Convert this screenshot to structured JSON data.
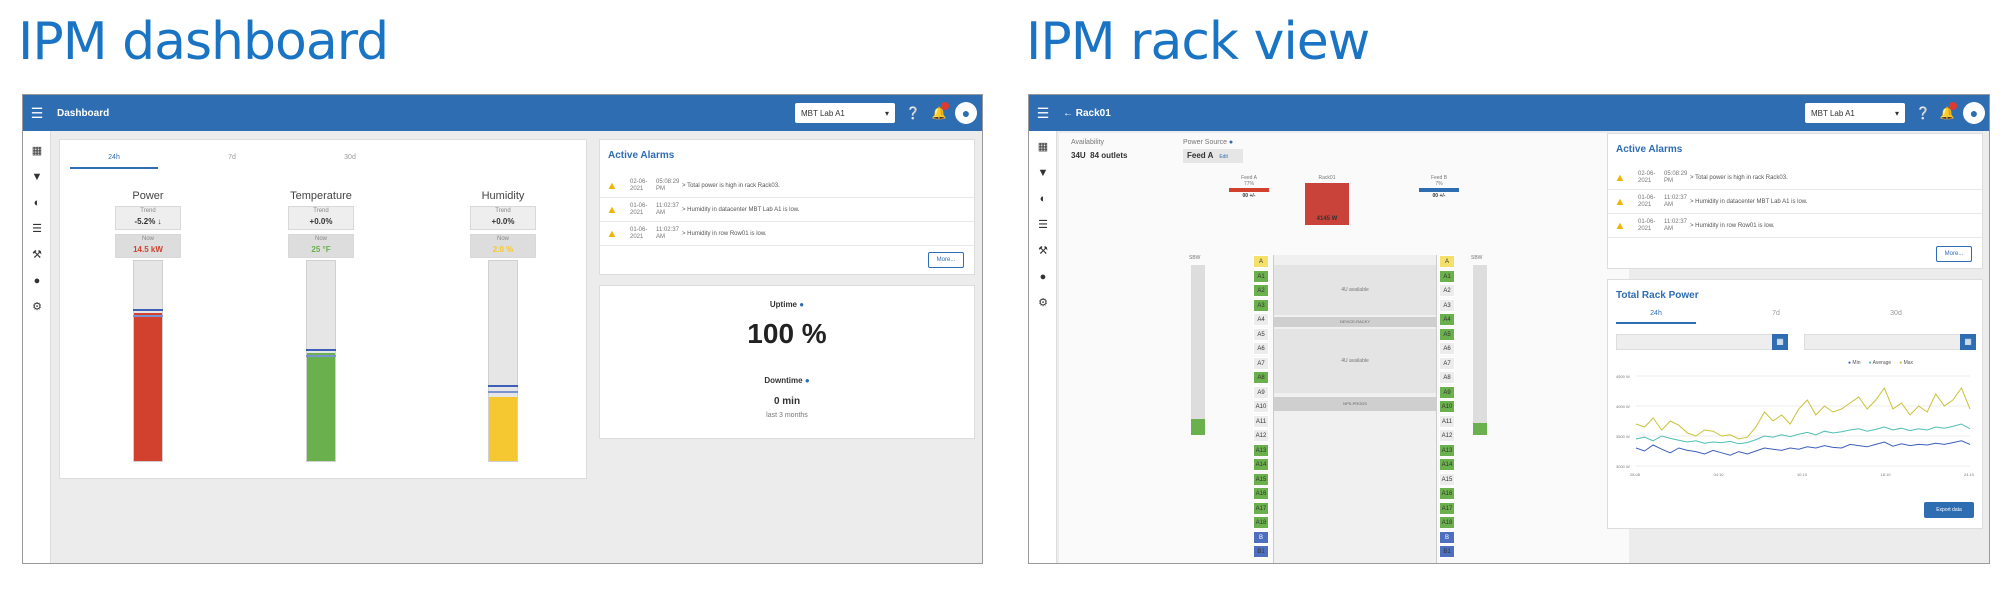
{
  "headings": {
    "left": "IPM dashboard",
    "right": "IPM rack view"
  },
  "colors": {
    "topbar": "#2f6db3",
    "heading": "#1a74c4",
    "red": "#d2402e",
    "green": "#6ab04c",
    "yellow": "#f5c730",
    "alarm": "#f0b400"
  },
  "dashboard": {
    "title": "Dashboard",
    "lab_select": "MBT Lab A1",
    "tabs": [
      "24h",
      "7d",
      "30d"
    ],
    "gauges": [
      {
        "title": "Power",
        "trend_label": "Trend",
        "trend": "-5.2% ↓",
        "now_label": "Now",
        "now": "14.5 kW",
        "level": 0.74
      },
      {
        "title": "Temperature",
        "trend_label": "Trend",
        "trend": "+0.0%",
        "now_label": "Now",
        "now": "25 °F",
        "level": 0.54
      },
      {
        "title": "Humidity",
        "trend_label": "Trend",
        "trend": "+0.0%",
        "now_label": "Now",
        "now": "2.0 %",
        "level": 0.32
      }
    ],
    "alarms": {
      "title": "Active Alarms",
      "rows": [
        {
          "date": "02-06-2021",
          "time": "05:08:29 PM",
          "msg": "> Total power is high in rack Rack03."
        },
        {
          "date": "01-06-2021",
          "time": "11:02:37 AM",
          "msg": "> Humidity in datacenter MBT Lab A1 is low."
        },
        {
          "date": "01-06-2021",
          "time": "11:02:37 AM",
          "msg": "> Humidity in row Row01 is low."
        }
      ],
      "more": "More..."
    },
    "uptime": {
      "label": "Uptime",
      "value": "100 %",
      "downtime_label": "Downtime",
      "downtime_value": "0 min",
      "period": "last 3 months"
    }
  },
  "rack": {
    "title": "← Rack01",
    "lab_select": "MBT Lab A1",
    "availability_label": "Availability",
    "availability": "34U  84 outlets",
    "power_source_label": "Power Source",
    "power_source": "Feed A",
    "edit": "Edit",
    "feed_a": "Feed A",
    "feed_a_pct": "77%",
    "feed_b": "Feed B",
    "feed_b_pct": "7%",
    "feed_value": "00 +/-",
    "rack_name": "Rack01",
    "rack_power": "4145 W",
    "left_col_label": "SBW",
    "right_col_label": "SBW",
    "slot_labels": [
      "A",
      "A1",
      "A2",
      "A3",
      "A4",
      "A5",
      "A6",
      "A7",
      "A8",
      "A9",
      "A10",
      "A11",
      "A12",
      "A13",
      "A14",
      "A15",
      "A16",
      "A17",
      "A18",
      "B",
      "B1"
    ],
    "u_available_1": "4U available",
    "u_available_2": "4U available",
    "device_1": "DEVICE-RACKY",
    "device_2": "NPS-PRODS",
    "alarms": {
      "title": "Active Alarms",
      "rows": [
        {
          "date": "02-06-2021",
          "time": "05:08:29 PM",
          "msg": "> Total power is high in rack Rack03."
        },
        {
          "date": "01-06-2021",
          "time": "11:02:37 AM",
          "msg": "> Humidity in datacenter MBT Lab A1 is low."
        },
        {
          "date": "01-06-2021",
          "time": "11:02:37 AM",
          "msg": "> Humidity in row Row01 is low."
        }
      ],
      "more": "More..."
    },
    "power_chart": {
      "title": "Total Rack Power",
      "tabs": [
        "24h",
        "7d",
        "30d"
      ],
      "legend": [
        "Min",
        "Average",
        "Max"
      ],
      "export": "Export data"
    }
  },
  "chart_data": {
    "type": "line",
    "title": "Total Rack Power",
    "x": [
      0,
      1,
      2,
      3,
      4,
      5,
      6,
      7,
      8,
      9,
      10,
      11,
      12,
      13,
      14,
      15,
      16,
      17,
      18,
      19,
      20,
      21,
      22,
      23,
      24,
      25,
      26,
      27,
      28,
      29,
      30,
      31,
      32,
      33,
      34,
      35,
      36,
      37,
      38,
      39
    ],
    "series": [
      {
        "name": "Max",
        "values": [
          3700,
          3650,
          3800,
          3600,
          3750,
          3680,
          3550,
          3500,
          3600,
          3580,
          3500,
          3520,
          3450,
          3480,
          3650,
          3900,
          3750,
          3850,
          3700,
          3950,
          4100,
          3850,
          4000,
          3900,
          3950,
          4050,
          4150,
          3950,
          4100,
          4300,
          3950,
          4050,
          3850,
          4000,
          3900,
          4200,
          4000,
          4100,
          4300,
          3950
        ]
      },
      {
        "name": "Average",
        "values": [
          3450,
          3480,
          3420,
          3500,
          3460,
          3430,
          3400,
          3420,
          3380,
          3400,
          3390,
          3410,
          3370,
          3390,
          3440,
          3500,
          3480,
          3520,
          3490,
          3530,
          3560,
          3520,
          3580,
          3550,
          3570,
          3600,
          3620,
          3580,
          3610,
          3650,
          3600,
          3630,
          3590,
          3620,
          3600,
          3650,
          3630,
          3660,
          3700,
          3620
        ]
      },
      {
        "name": "Min",
        "values": [
          3300,
          3250,
          3350,
          3280,
          3220,
          3300,
          3260,
          3240,
          3200,
          3260,
          3220,
          3180,
          3240,
          3200,
          3250,
          3300,
          3280,
          3260,
          3300,
          3280,
          3320,
          3300,
          3340,
          3310,
          3300,
          3360,
          3340,
          3320,
          3360,
          3400,
          3330,
          3370,
          3340,
          3360,
          3350,
          3380,
          3360,
          3390,
          3420,
          3360
        ]
      }
    ],
    "ylim": [
      3000,
      4500
    ],
    "yticks": [
      "4500 W",
      "4000 W",
      "3500 W",
      "3000 W"
    ],
    "xticks": [
      "28.08",
      "04.10",
      "10.10",
      "18.10",
      "24.10"
    ]
  }
}
